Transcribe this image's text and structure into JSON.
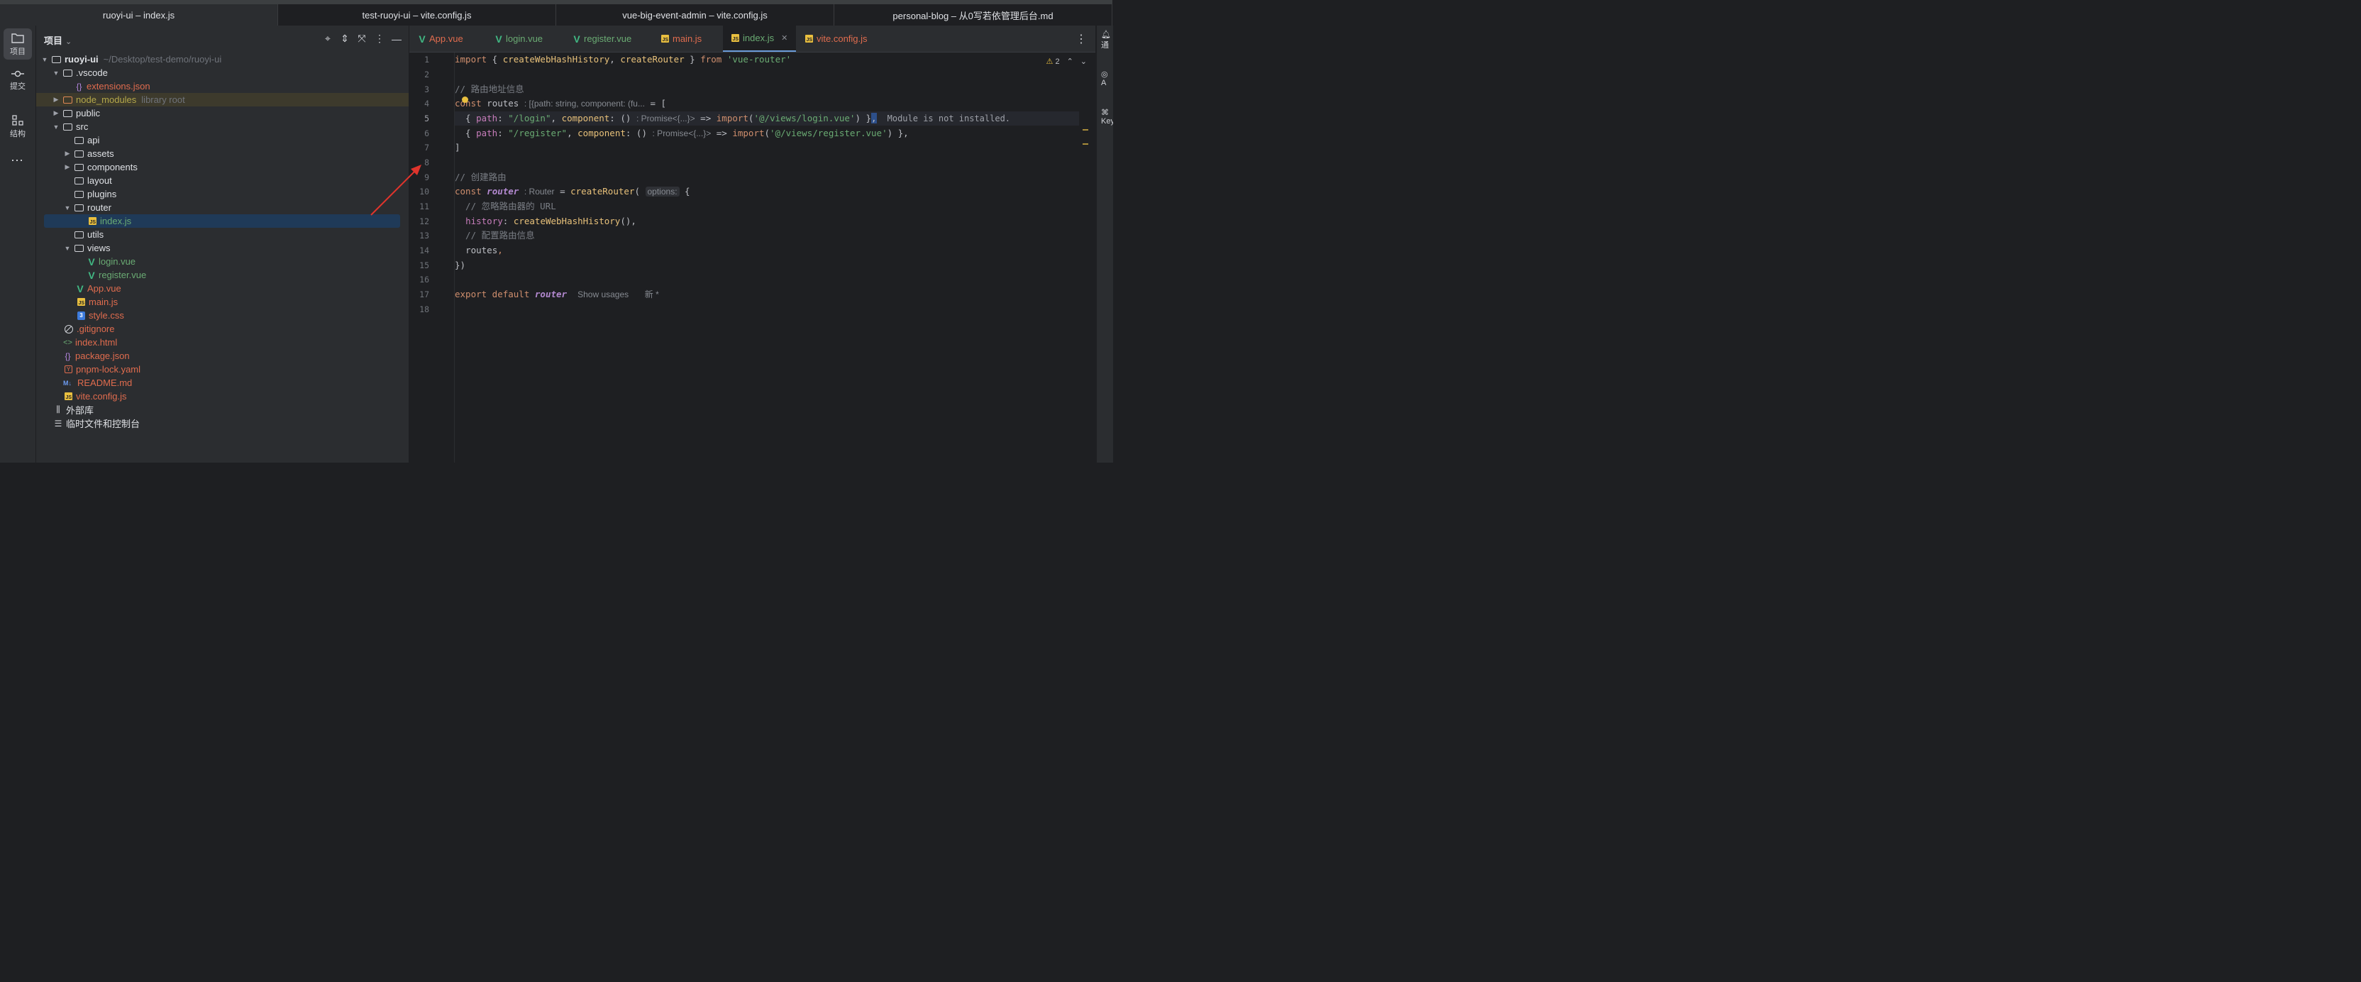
{
  "window_tabs": [
    {
      "label": "ruoyi-ui – index.js",
      "active": true
    },
    {
      "label": "test-ruoyi-ui – vite.config.js",
      "active": false
    },
    {
      "label": "vue-big-event-admin – vite.config.js",
      "active": false
    },
    {
      "label": "personal-blog – 从0写若依管理后台.md",
      "active": false
    }
  ],
  "sidebar": {
    "project_label": "项目",
    "commit_label": "提交",
    "structure_label": "结构",
    "more": "⋯"
  },
  "project_panel": {
    "title": "项目",
    "root_name": "ruoyi-ui",
    "root_path": "~/Desktop/test-demo/ruoyi-ui",
    "nodes": {
      "vscode": ".vscode",
      "extensions": "extensions.json",
      "node_modules": "node_modules",
      "node_modules_hint": "library root",
      "public": "public",
      "src": "src",
      "api": "api",
      "assets": "assets",
      "components": "components",
      "layout": "layout",
      "plugins": "plugins",
      "router": "router",
      "router_index": "index.js",
      "utils": "utils",
      "views": "views",
      "login_vue": "login.vue",
      "register_vue": "register.vue",
      "app_vue": "App.vue",
      "main_js": "main.js",
      "style_css": "style.css",
      "gitignore": ".gitignore",
      "index_html": "index.html",
      "package_json": "package.json",
      "pnpm_lock": "pnpm-lock.yaml",
      "readme": "README.md",
      "vite_config": "vite.config.js",
      "external_libs": "外部库",
      "scratches": "临时文件和控制台"
    }
  },
  "editor_tabs": [
    {
      "label": "App.vue",
      "icon": "vue-icon",
      "color": "#e06c4e"
    },
    {
      "label": "login.vue",
      "icon": "vue-icon",
      "color": "#6aab73"
    },
    {
      "label": "register.vue",
      "icon": "vue-icon",
      "color": "#6aab73"
    },
    {
      "label": "main.js",
      "icon": "js-icon",
      "color": "#e06c4e"
    },
    {
      "label": "index.js",
      "icon": "js-icon",
      "color": "#6aab73",
      "active": true
    },
    {
      "label": "vite.config.js",
      "icon": "js-icon",
      "color": "#e06c4e"
    }
  ],
  "editor": {
    "warning_count": "2",
    "line_numbers": [
      "1",
      "2",
      "3",
      "4",
      "5",
      "6",
      "7",
      "8",
      "9",
      "10",
      "11",
      "12",
      "13",
      "14",
      "15",
      "16",
      "17",
      "18"
    ],
    "current_line": "5",
    "code": {
      "l1_import": "import",
      "l1_mid": " { ",
      "l1_f1": "createWebHashHistory",
      "l1_comma": ", ",
      "l1_f2": "createRouter",
      "l1_close": " } ",
      "l1_from": "from",
      "l1_str": "'vue-router'",
      "l3_comment": "// 路由地址信息",
      "l4_const": "const",
      "l4_name": "routes",
      "l4_hint": ": [{path: string, component: (fu...",
      "l4_eq": " = [",
      "l5_open": "  { ",
      "l5_path": "path",
      "l5_colon": ": ",
      "l5_str": "\"/login\"",
      "l5_comma": ", ",
      "l5_comp": "component",
      "l5_arrow_open": ": () ",
      "l5_hint": ": Promise<{...}>",
      "l5_arrow": " => ",
      "l5_import": "import",
      "l5_paren": "(",
      "l5_mod": "'@/views/login.vue'",
      "l5_close": ") }",
      "l5_end": ",",
      "l5_err": "Module is not installed.",
      "l6_open": "  { ",
      "l6_path": "path",
      "l6_colon": ": ",
      "l6_str": "\"/register\"",
      "l6_comma": ", ",
      "l6_comp": "component",
      "l6_arrow_open": ": () ",
      "l6_hint": ": Promise<{...}>",
      "l6_arrow": " => ",
      "l6_import": "import",
      "l6_paren": "(",
      "l6_mod": "'@/views/register.vue'",
      "l6_close": ") },",
      "l7": "]",
      "l9_comment": "// 创建路由",
      "l10_const": "const",
      "l10_name": "router",
      "l10_hint": ": Router",
      "l10_eq": " = ",
      "l10_fn": "createRouter",
      "l10_paren": "(",
      "l10_opt": "options:",
      "l10_brace": " {",
      "l11_comment": "  // 忽略路由器的 URL",
      "l12_prop": "history",
      "l12_colon": ": ",
      "l12_fn": "createWebHashHistory",
      "l12_end": "(),",
      "l13_comment": "  // 配置路由信息",
      "l14_prop": "routes",
      "l14_end": ",",
      "l15": "})",
      "l17_export": "export",
      "l17_default": " default ",
      "l17_name": "router",
      "l17_usages": "Show usages",
      "l17_new": "新 *"
    }
  },
  "right_stripe": {
    "notifications": "通",
    "ai": "A",
    "key": "Key"
  },
  "colors": {
    "accent": "#6a9bd8",
    "selection": "#1f3a58",
    "annotation_arrow": "#e0342c"
  }
}
